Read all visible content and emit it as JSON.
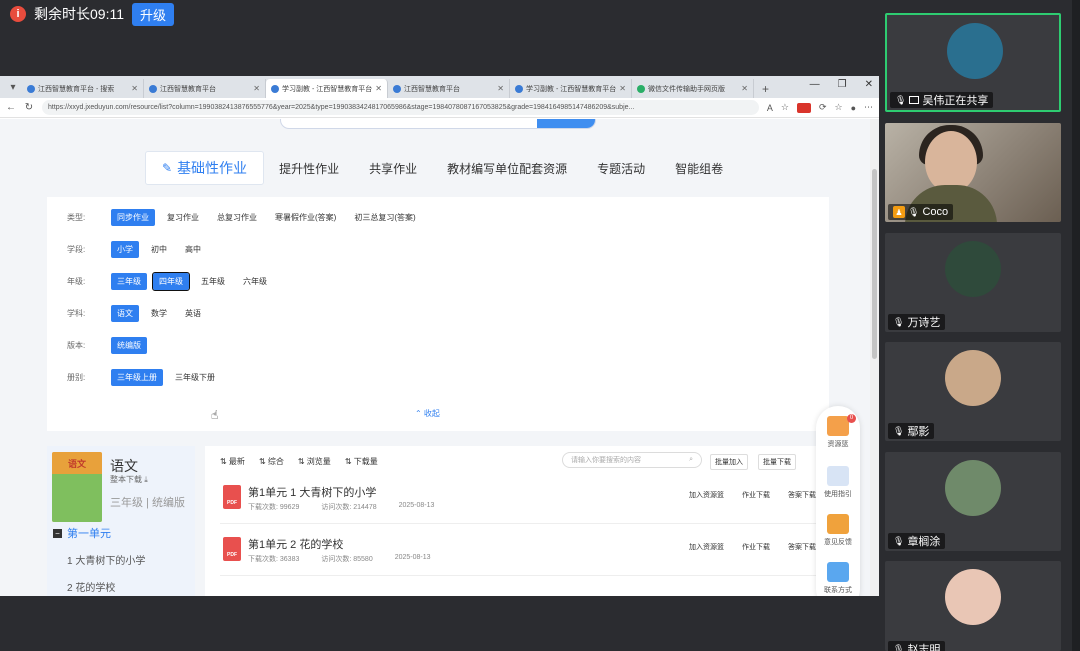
{
  "meeting": {
    "timer_text": "剩余时长09:11",
    "upgrade_label": "升级",
    "info_icon": "i"
  },
  "browser": {
    "tabs": [
      {
        "label": "江西智慧教育平台 - 搜索"
      },
      {
        "label": "江西智慧教育平台"
      },
      {
        "label": "学习副教 - 江西智慧教育平台"
      },
      {
        "label": "江西智慧教育平台"
      },
      {
        "label": "学习副教 - 江西智慧教育平台"
      },
      {
        "label": "微信文件传输助手网页版"
      }
    ],
    "url": "https://xxyd.jxeduyun.com/resource/list?column=1990382413876555776&year=2025&type=1990383424817065986&stage=1984078087167053825&grade=1984164985147486209&subje..."
  },
  "categories": [
    "基础性作业",
    "提升性作业",
    "共享作业",
    "教材编写单位配套资源",
    "专题活动",
    "智能组卷"
  ],
  "filters": {
    "type": {
      "label": "类型:",
      "options": [
        "同步作业",
        "复习作业",
        "总复习作业",
        "寒暑假作业(答案)",
        "初三总复习(答案)"
      ]
    },
    "stage": {
      "label": "学段:",
      "options": [
        "小学",
        "初中",
        "高中"
      ]
    },
    "grade": {
      "label": "年级:",
      "options": [
        "三年级",
        "四年级",
        "五年级",
        "六年级"
      ]
    },
    "subject": {
      "label": "学科:",
      "options": [
        "语文",
        "数学",
        "英语"
      ]
    },
    "edition": {
      "label": "版本:",
      "options": [
        "统编版"
      ]
    },
    "volume": {
      "label": "册别:",
      "options": [
        "三年级上册",
        "三年级下册"
      ]
    },
    "collapse_label": "⌃ 收起"
  },
  "book": {
    "cover_text": "语文",
    "title": "语文",
    "download": "整本下载 ⤓",
    "meta": "三年级 | 统编版",
    "unit": "第一单元",
    "unit_icon": "−",
    "lessons": [
      "1 大青树下的小学",
      "2 花的学校"
    ]
  },
  "list": {
    "sort": [
      "⇅ 最新",
      "⇅ 综合",
      "⇅ 浏览量",
      "⇅ 下载量"
    ],
    "search_placeholder": "请输入你要搜索的内容",
    "batch": [
      "批量加入",
      "批量下载"
    ],
    "items": [
      {
        "title": "第1单元 1 大青树下的小学",
        "downloads": "下载次数: 99629",
        "visits": "访问次数: 214478",
        "date": "2025-08-13"
      },
      {
        "title": "第1单元 2 花的学校",
        "downloads": "下载次数: 36383",
        "visits": "访问次数: 85580",
        "date": "2025-08-13"
      }
    ],
    "actions": [
      "加入资源篮",
      "作业下载",
      "答案下载"
    ]
  },
  "float_bar": {
    "badge": "0",
    "items": [
      "资源篮",
      "使用指引",
      "意见反馈",
      "联系方式"
    ]
  },
  "participants": [
    {
      "name": "吴伟正在共享",
      "role": "sharing"
    },
    {
      "name": "Coco",
      "role": "host"
    },
    {
      "name": "万诗艺"
    },
    {
      "name": "鄢影"
    },
    {
      "name": "章榈涂"
    },
    {
      "name": "赵志明"
    }
  ],
  "colors": {
    "accent": "#2f7ff0",
    "active_speaker": "#2ecc71",
    "pdf": "#e8504e"
  }
}
